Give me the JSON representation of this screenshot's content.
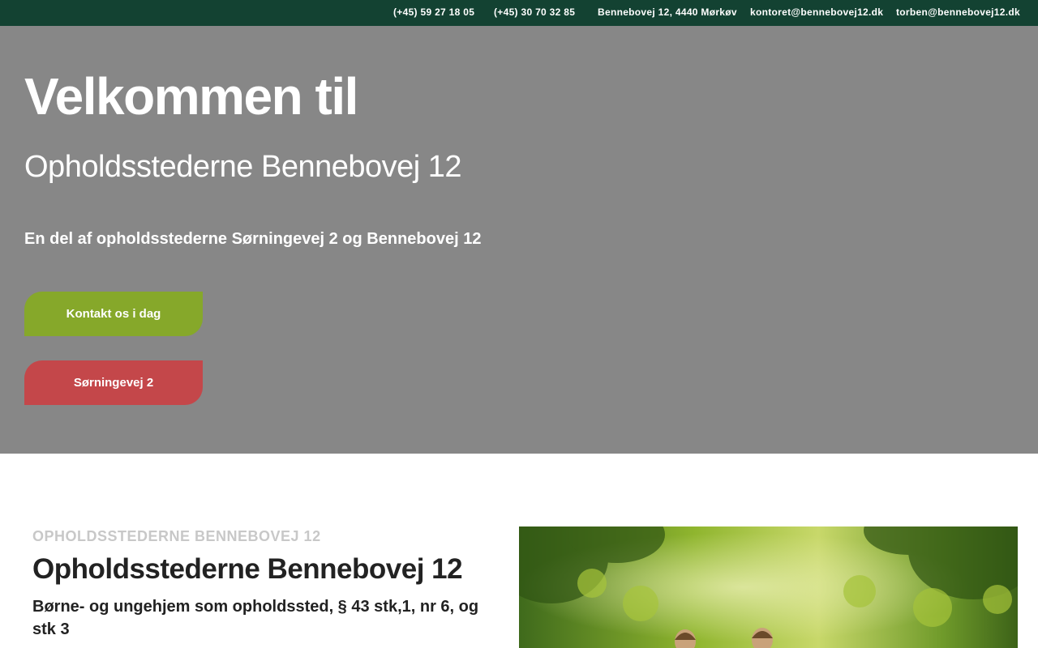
{
  "topbar": {
    "items": [
      {
        "text": "(+45) 59 27 18 05"
      },
      {
        "text": "(+45) 30 70 32 85"
      },
      {
        "text": "Bennebovej 12, 4440 Mørkøv"
      },
      {
        "text": "kontoret@bennebovej12.dk"
      },
      {
        "text": "torben@bennebovej12.dk"
      }
    ]
  },
  "hero": {
    "title": "Velkommen til",
    "subtitle": "Opholdsstederne Bennebovej 12",
    "tagline": "En del af opholdsstederne Sørningevej 2 og Bennebovej 12",
    "contact_button": "Kontakt os i dag",
    "sorningevej_button": "Sørningevej 2"
  },
  "section": {
    "eyebrow": "Opholdsstederne Bennebovej 12",
    "title": "Opholdsstederne Bennebovej 12",
    "subtitle": "Børne- og ungehjem som opholdssted, § 43 stk,1, nr 6, og stk 3"
  },
  "colors": {
    "topbar_bg": "#134232",
    "hero_bg": "#878787",
    "contact_button": "#86a82a",
    "sorningevej_button": "#c4474a"
  }
}
